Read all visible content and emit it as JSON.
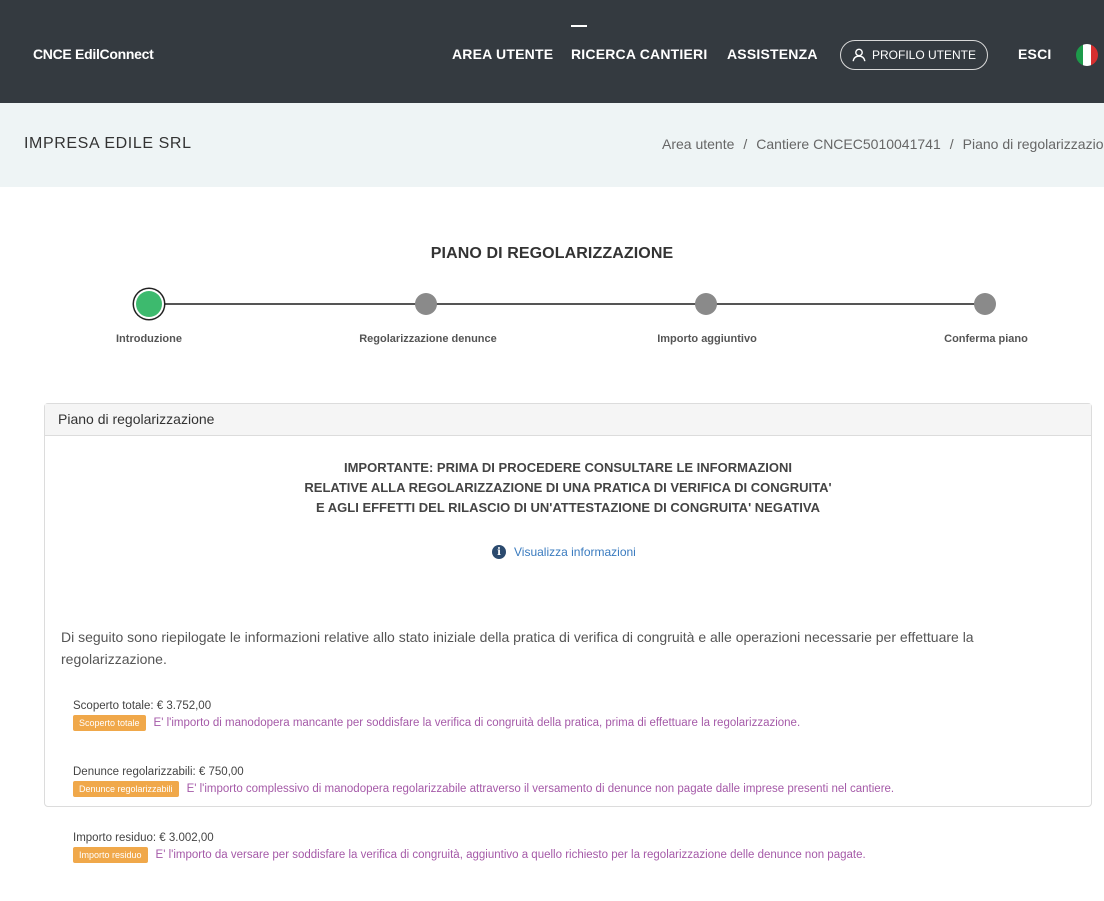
{
  "header": {
    "brand": "CNCE EdilConnect",
    "nav": [
      "AREA UTENTE",
      "RICERCA CANTIERI",
      "ASSISTENZA"
    ],
    "profile_label": "PROFILO UTENTE",
    "logout_label": "ESCI",
    "language_flag_colors": [
      "#1d9a4a",
      "#ffffff",
      "#d62f2f"
    ]
  },
  "subheader": {
    "company": "IMPRESA EDILE SRL",
    "breadcrumb": [
      "Area utente",
      "Cantiere CNCEC5010041741",
      "Piano di regolarizzazione"
    ]
  },
  "page": {
    "title": "PIANO DI REGOLARIZZAZIONE"
  },
  "stepper": {
    "steps": [
      "Introduzione",
      "Regolarizzazione denunce",
      "Importo aggiuntivo",
      "Conferma piano"
    ],
    "active_index": 0,
    "active_color": "#3dba6e"
  },
  "card": {
    "title": "Piano di regolarizzazione",
    "important_lines": [
      "IMPORTANTE: PRIMA DI PROCEDERE CONSULTARE LE INFORMAZIONI",
      "RELATIVE ALLA REGOLARIZZAZIONE DI UNA PRATICA DI VERIFICA DI CONGRUITA'",
      "E AGLI EFFETTI DEL RILASCIO DI UN'ATTESTAZIONE DI CONGRUITA' NEGATIVA"
    ],
    "info_link": "Visualizza informazioni",
    "intro": "Di seguito sono riepilogate le informazioni relative allo stato iniziale della pratica di verifica di congruità e alle operazioni necessarie per effettuare la regolarizzazione.",
    "items": [
      {
        "label": "Scoperto totale: € 3.752,00",
        "badge": "Scoperto totale",
        "description": "E' l'importo di manodopera mancante per soddisfare la verifica di congruità della pratica, prima di effettuare la regolarizzazione."
      },
      {
        "label": "Denunce regolarizzabili: € 750,00",
        "badge": "Denunce regolarizzabili",
        "description": "E' l'importo complessivo di manodopera regolarizzabile attraverso il versamento di denunce non pagate dalle imprese presenti nel cantiere."
      },
      {
        "label": "Importo residuo: € 3.002,00",
        "badge": "Importo residuo",
        "description": "E' l'importo da versare per soddisfare la verifica di congruità, aggiuntivo a quello richiesto per la regolarizzazione delle denunce non pagate."
      }
    ]
  }
}
